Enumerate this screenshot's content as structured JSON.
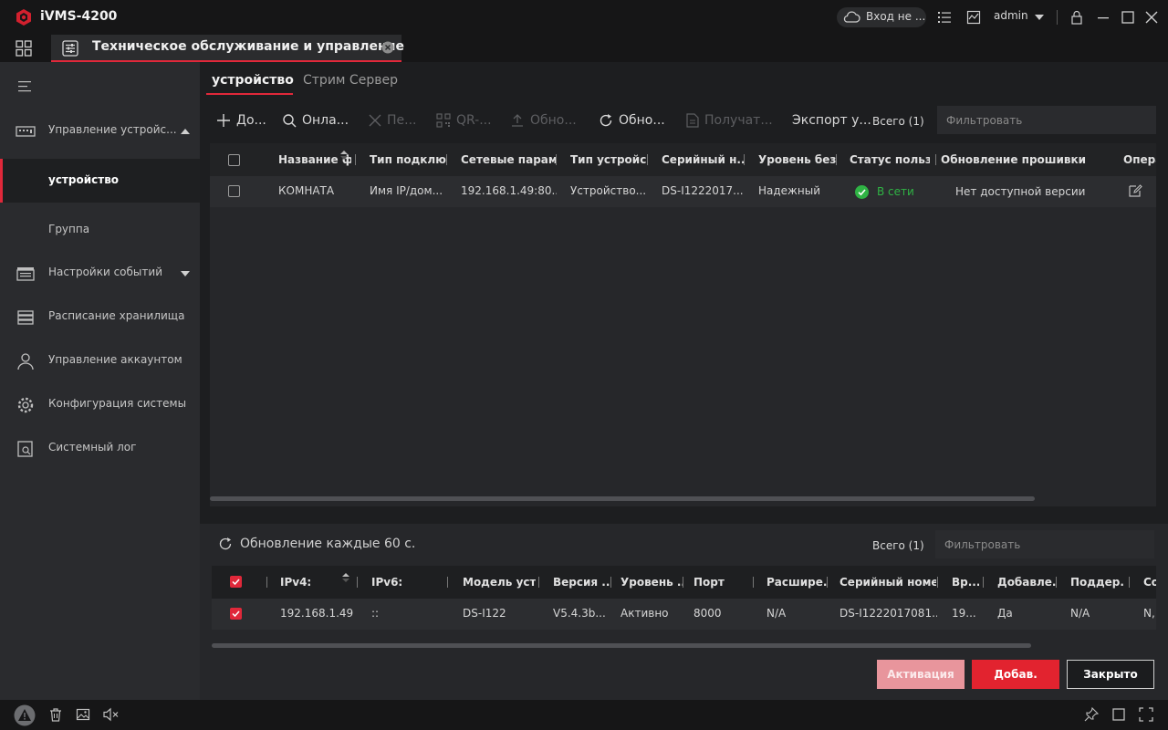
{
  "app": {
    "title": "iVMS-4200",
    "cloud_text": "Вход не ...",
    "user": "admin",
    "icons": [
      "logo-icon",
      "cloud-icon",
      "list-icon",
      "monitor-icon",
      "user-caret-icon",
      "lock-icon",
      "minimize-icon",
      "maximize-icon",
      "close-icon"
    ]
  },
  "main_tab": {
    "label": "Техническое обслуживание и управление"
  },
  "sidebar": {
    "items": [
      {
        "label": "Управление устройс...",
        "icon": "device-management-icon"
      },
      {
        "label": "устройство"
      },
      {
        "label": "Группа"
      },
      {
        "label": "Настройки событий",
        "icon": "event-icon"
      },
      {
        "label": "Расписание хранилища",
        "icon": "storage-icon"
      },
      {
        "label": "Управление аккаунтом",
        "icon": "account-icon"
      },
      {
        "label": "Конфигурация системы",
        "icon": "gear-icon"
      },
      {
        "label": "Системный лог",
        "icon": "log-icon"
      }
    ]
  },
  "subtabs": {
    "device": "устройство",
    "stream": "Стрим Сервер"
  },
  "toolbar": {
    "add": "До...",
    "online": "Онла...",
    "delete": "Пе...",
    "qr": "QR-...",
    "upgrade": "Обно...",
    "refresh": "Обно...",
    "get": "Получат...",
    "export": "Экспорт у...",
    "total": "Всего (1)",
    "filter_placeholder": "Фильтровать"
  },
  "devices_table": {
    "headers": [
      "Название ф...",
      "Тип подклю...",
      "Сетевые парам...",
      "Тип устройс...",
      "Серийный н...",
      "Уровень без...",
      "Статус польз...",
      "Обновление прошивки",
      "Опера"
    ],
    "rows": [
      {
        "name": "КОМНАТА",
        "conn_type": "Имя IP/дом...",
        "net_params": "192.168.1.49:80...",
        "dev_type": "Устройство...",
        "serial": "DS-I1222017...",
        "security": "Надежный",
        "status": "В сети",
        "firmware": "Нет доступной версии"
      }
    ]
  },
  "online_panel": {
    "refresh_text": "Обновление каждые 60 с.",
    "total": "Всего (1)",
    "filter_placeholder": "Фильтровать",
    "headers": [
      "IPv4:",
      "IPv6:",
      "Модель уст...",
      "Версия ...",
      "Уровень ...",
      "Порт",
      "Расшире...",
      "Серийный номер",
      "Вр...",
      "Добавле...",
      "Поддер...",
      "Co"
    ],
    "rows": [
      {
        "ipv4": "192.168.1.49",
        "ipv6": "::",
        "model": "DS-I122",
        "version": "V5.4.3b...",
        "level": "Активно",
        "port": "8000",
        "ext": "N/A",
        "serial": "DS-I1222017081...",
        "time": "19...",
        "added": "Да",
        "support": "N/A",
        "co": "N,"
      }
    ]
  },
  "buttons": {
    "activate": "Активация",
    "add": "Добав.",
    "close": "Закрыто"
  },
  "colors": {
    "accent": "#e0283a",
    "online_green": "#2fb344",
    "activate_disabled": "#e8959c"
  }
}
